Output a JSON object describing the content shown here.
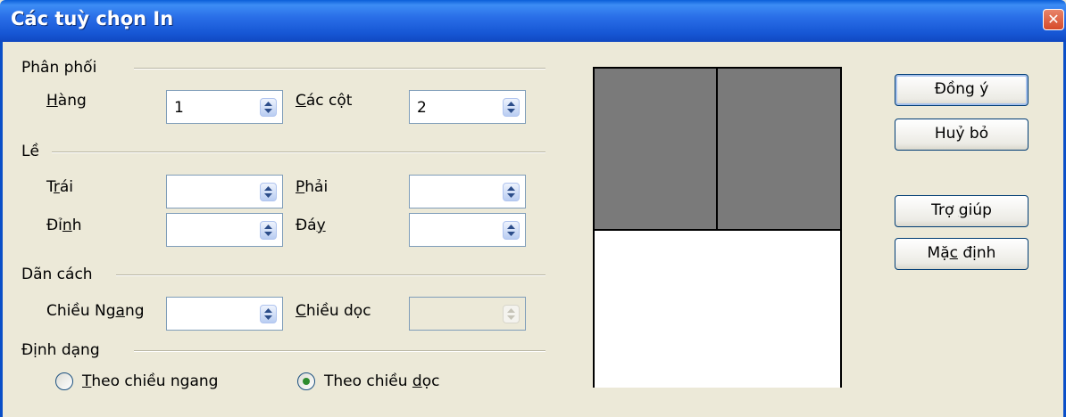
{
  "window": {
    "title": "Các tuỳ chọn In"
  },
  "sections": {
    "distribution": "Phân phối",
    "margins": "Lề",
    "spacing": "Dãn cách",
    "format": "Định dạng"
  },
  "fields": {
    "rows": {
      "label": "Hàng",
      "value": "1"
    },
    "columns": {
      "label": "Các cột",
      "value": "2"
    },
    "left": {
      "label": "Trái",
      "value": ""
    },
    "right": {
      "label": "Phải",
      "value": ""
    },
    "top": {
      "label": "Đỉnh",
      "value": ""
    },
    "bottom": {
      "label": "Đáy",
      "value": ""
    },
    "horizontal": {
      "label": "Chiều Ngang",
      "value": ""
    },
    "vertical": {
      "label": "Chiều dọc",
      "value": ""
    }
  },
  "format_options": [
    {
      "label": "Theo chiều ngang",
      "selected": false
    },
    {
      "label": "Theo chiều dọc",
      "selected": true
    }
  ],
  "buttons": {
    "ok": "Đồng ý",
    "cancel": "Huỷ bỏ",
    "help": "Trợ giúp",
    "default": "Mặc định"
  },
  "preview": {
    "rows": 1,
    "columns": 2
  },
  "icons": {
    "close": "close-icon",
    "spin": "spin-arrows-icon"
  },
  "colors": {
    "title_bar": "#2a6fe8",
    "preview_page": "#7a7a7a",
    "selected_radio": "#2d8b2d"
  }
}
